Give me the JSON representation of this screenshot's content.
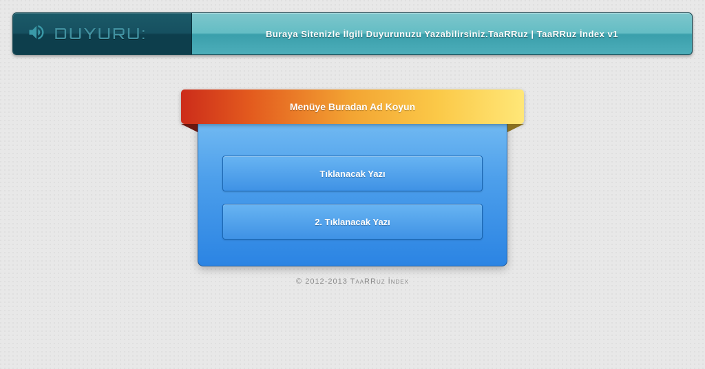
{
  "announcement": {
    "label": "Duyuru:",
    "text": "Buraya Sitenizle İlgili Duyurunuzu Yazabilirsiniz.TaaRRuz | TaaRRuz İndex v1"
  },
  "menu": {
    "title": "Menüye Buradan Ad Koyun",
    "items": [
      {
        "label": "Tıklanacak Yazı"
      },
      {
        "label": "2. Tıklanacak Yazı"
      }
    ]
  },
  "footer": {
    "copyright": "© 2012-2013 TaaRRuz İndex"
  }
}
